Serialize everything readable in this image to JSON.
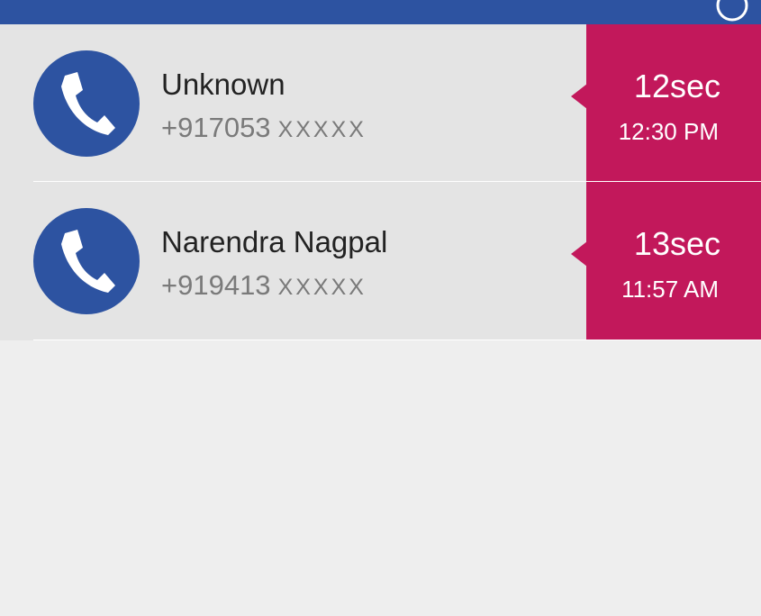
{
  "colors": {
    "header": "#2d53a1",
    "row_background": "#e4e4e4",
    "badge": "#c2185b",
    "avatar": "#2d53a1",
    "page_background": "#eeeeee"
  },
  "calls": [
    {
      "name": "Unknown",
      "number": "+917053",
      "number_mask": "XXXXX",
      "duration": "12sec",
      "time": "12:30 PM",
      "icon": "phone-icon"
    },
    {
      "name": "Narendra Nagpal",
      "number": "+919413",
      "number_mask": "XXXXX",
      "duration": "13sec",
      "time": "11:57 AM",
      "icon": "phone-icon"
    }
  ]
}
